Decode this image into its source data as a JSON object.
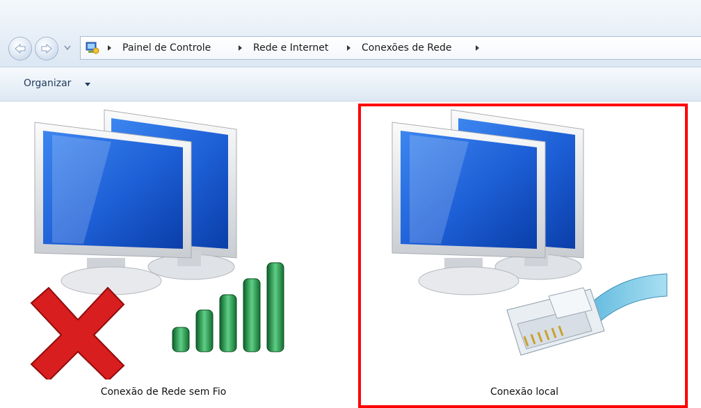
{
  "breadcrumb": [
    "Painel de Controle",
    "Rede e Internet",
    "Conexões de Rede"
  ],
  "toolbar": {
    "organize_label": "Organizar"
  },
  "items": [
    {
      "label": "Conexão de Rede sem Fio",
      "type": "wireless",
      "status_icon": "red-x-icon",
      "signal_bars": 5
    },
    {
      "label": "Conexão local",
      "type": "ethernet",
      "status_icon": "ethernet-cable-icon",
      "selected": true
    }
  ],
  "colors": {
    "highlight": "#ff0000",
    "screen_blue": "#1d5fd6",
    "signal_green": "#1f8a3c"
  }
}
